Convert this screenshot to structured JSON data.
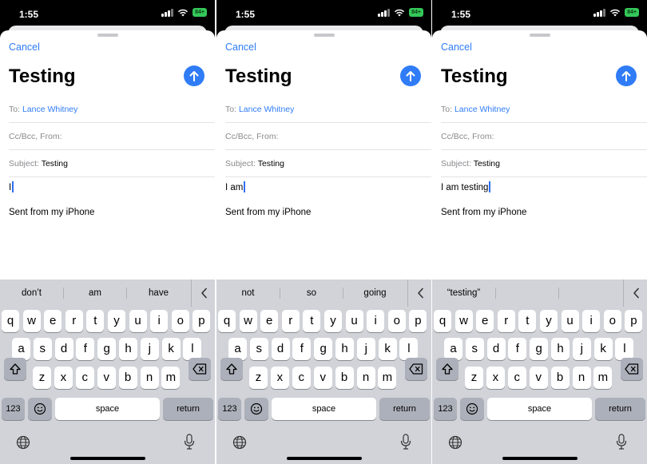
{
  "screens": [
    {
      "status": {
        "time": "1:55",
        "battery": "84+"
      },
      "nav": {
        "cancel": "Cancel"
      },
      "title": "Testing",
      "fields": {
        "to_label": "To:",
        "to_value": "Lance Whitney",
        "cc_label": "Cc/Bcc, From:",
        "subject_label": "Subject:",
        "subject_value": "Testing"
      },
      "body_text": "I",
      "signature": "Sent from my iPhone",
      "suggestions": [
        "don’t",
        "am",
        "have"
      ],
      "keys": {
        "numbers": "123",
        "space": "space",
        "return": "return"
      }
    },
    {
      "status": {
        "time": "1:55",
        "battery": "84+"
      },
      "nav": {
        "cancel": "Cancel"
      },
      "title": "Testing",
      "fields": {
        "to_label": "To:",
        "to_value": "Lance Whitney",
        "cc_label": "Cc/Bcc, From:",
        "subject_label": "Subject:",
        "subject_value": "Testing"
      },
      "body_text": "I am",
      "signature": "Sent from my iPhone",
      "suggestions": [
        "not",
        "so",
        "going"
      ],
      "keys": {
        "numbers": "123",
        "space": "space",
        "return": "return"
      }
    },
    {
      "status": {
        "time": "1:55",
        "battery": "84+"
      },
      "nav": {
        "cancel": "Cancel"
      },
      "title": "Testing",
      "fields": {
        "to_label": "To:",
        "to_value": "Lance Whitney",
        "cc_label": "Cc/Bcc, From:",
        "subject_label": "Subject:",
        "subject_value": "Testing"
      },
      "body_text": "I am testing",
      "signature": "Sent from my iPhone",
      "suggestions": [
        "“testing”",
        "",
        ""
      ],
      "keys": {
        "numbers": "123",
        "space": "space",
        "return": "return"
      }
    }
  ],
  "keyboard_rows": [
    [
      "q",
      "w",
      "e",
      "r",
      "t",
      "y",
      "u",
      "i",
      "o",
      "p"
    ],
    [
      "a",
      "s",
      "d",
      "f",
      "g",
      "h",
      "j",
      "k",
      "l"
    ],
    [
      "z",
      "x",
      "c",
      "v",
      "b",
      "n",
      "m"
    ]
  ],
  "colors": {
    "accent": "#2f7cf6",
    "keyboard": "#d1d3d9",
    "battery": "#34c759"
  },
  "icons": [
    "signal-icon",
    "wifi-icon",
    "battery-icon",
    "arrow-up-icon",
    "shift-icon",
    "backspace-icon",
    "emoji-icon",
    "globe-icon",
    "microphone-icon",
    "chevron-left-icon"
  ]
}
